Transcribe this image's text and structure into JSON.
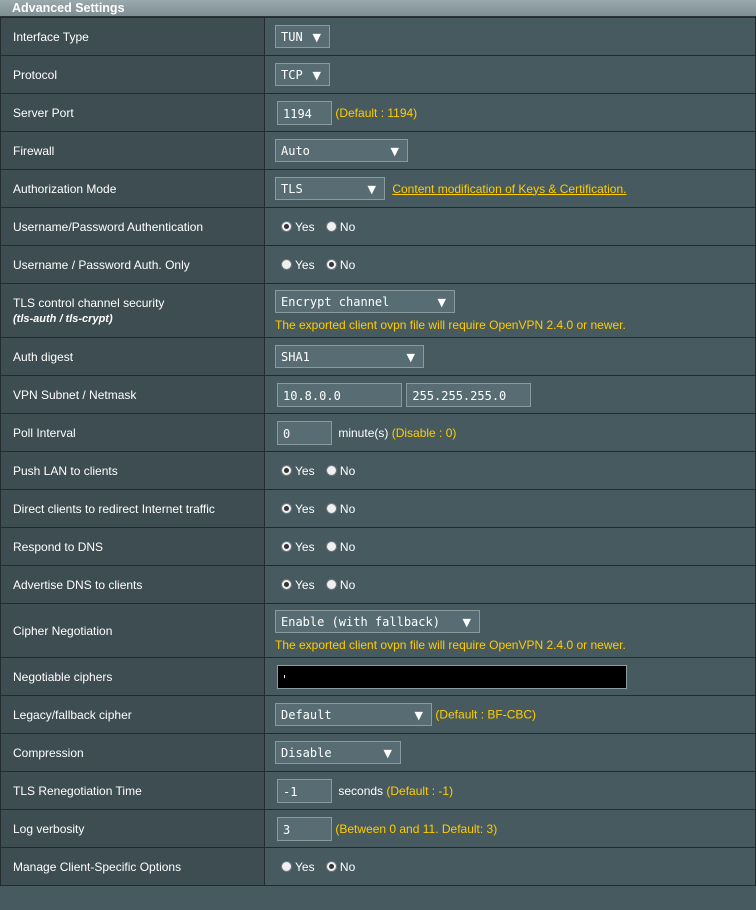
{
  "header": {
    "title": "Advanced Settings"
  },
  "radio_labels": {
    "yes": "Yes",
    "no": "No"
  },
  "rows": {
    "interface_type": {
      "label": "Interface Type",
      "value": "TUN"
    },
    "protocol": {
      "label": "Protocol",
      "value": "TCP"
    },
    "server_port": {
      "label": "Server Port",
      "value": "1194",
      "note": "(Default : 1194)"
    },
    "firewall": {
      "label": "Firewall",
      "value": "Auto"
    },
    "auth_mode": {
      "label": "Authorization Mode",
      "value": "TLS",
      "link": "Content modification of Keys & Certification."
    },
    "userpass_auth": {
      "label": "Username/Password Authentication",
      "selected": "Yes"
    },
    "userpass_only": {
      "label": "Username / Password Auth. Only",
      "selected": "No"
    },
    "tls_control": {
      "label": "TLS control channel security",
      "sublabel": "(tls-auth / tls-crypt)",
      "value": "Encrypt channel",
      "note": "The exported client ovpn file will require OpenVPN 2.4.0 or newer."
    },
    "auth_digest": {
      "label": "Auth digest",
      "value": "SHA1"
    },
    "vpn_subnet": {
      "label": "VPN Subnet / Netmask",
      "subnet": "10.8.0.0",
      "netmask": "255.255.255.0"
    },
    "poll_interval": {
      "label": "Poll Interval",
      "value": "0",
      "unit": "minute(s)",
      "note": "(Disable : 0)"
    },
    "push_lan": {
      "label": "Push LAN to clients",
      "selected": "Yes"
    },
    "redirect_internet": {
      "label": "Direct clients to redirect Internet traffic",
      "selected": "Yes"
    },
    "respond_dns": {
      "label": "Respond to DNS",
      "selected": "Yes"
    },
    "advertise_dns": {
      "label": "Advertise DNS to clients",
      "selected": "Yes"
    },
    "cipher_negotiation": {
      "label": "Cipher Negotiation",
      "value": "Enable (with fallback)",
      "note": "The exported client ovpn file will require OpenVPN 2.4.0 or newer."
    },
    "negotiable_ciphers": {
      "label": "Negotiable ciphers",
      "value": ""
    },
    "legacy_cipher": {
      "label": "Legacy/fallback cipher",
      "value": "Default",
      "note": "(Default : BF-CBC)"
    },
    "compression": {
      "label": "Compression",
      "value": "Disable"
    },
    "tls_reneg": {
      "label": "TLS Renegotiation Time",
      "value": "-1",
      "unit": "seconds",
      "note": "(Default : -1)"
    },
    "log_verbosity": {
      "label": "Log verbosity",
      "value": "3",
      "note": "(Between 0 and 11. Default: 3)"
    },
    "client_specific": {
      "label": "Manage Client-Specific Options",
      "selected": "No"
    }
  },
  "colors": {
    "background": "#475a5f",
    "label_bg": "#3d4d51",
    "accent": "#ffcc00"
  }
}
